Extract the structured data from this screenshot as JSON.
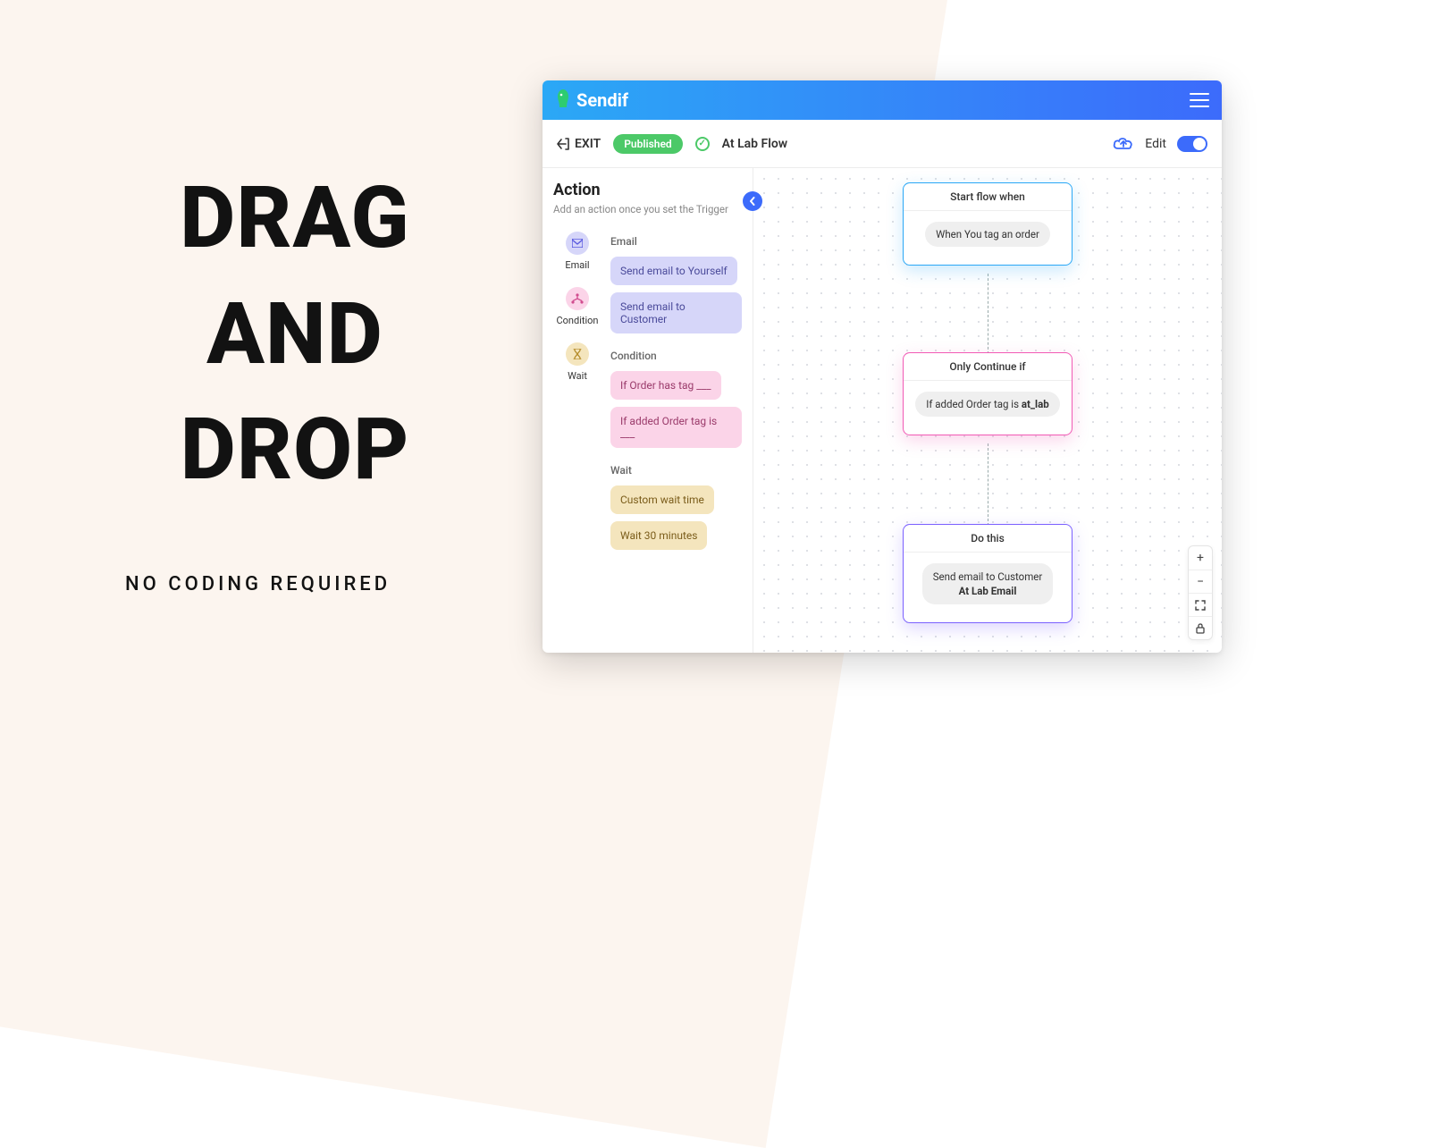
{
  "hero": {
    "line1": "DRAG",
    "line2": "AND",
    "line3": "DROP",
    "subtitle": "NO CODING REQUIRED"
  },
  "app": {
    "brand": "Sendif",
    "toolbar": {
      "exit_label": "EXIT",
      "status_badge": "Published",
      "flow_name": "At Lab Flow",
      "edit_label": "Edit"
    },
    "sidebar": {
      "title": "Action",
      "description": "Add an action once you set the Trigger",
      "tabs": {
        "email": "Email",
        "condition": "Condition",
        "wait": "Wait"
      },
      "groups": {
        "email": {
          "label": "Email",
          "actions": [
            "Send email to Yourself",
            "Send email to Customer"
          ]
        },
        "condition": {
          "label": "Condition",
          "actions": [
            "If Order has tag ___",
            "If added Order tag is ___"
          ]
        },
        "wait": {
          "label": "Wait",
          "actions": [
            "Custom wait time",
            "Wait 30 minutes"
          ]
        }
      }
    },
    "canvas": {
      "trigger": {
        "header": "Start flow when",
        "chip": "When You tag an order"
      },
      "condition": {
        "header": "Only Continue if",
        "chip_prefix": "If added Order tag is ",
        "chip_bold": "at_lab"
      },
      "action": {
        "header": "Do this",
        "chip_line1": "Send email to Customer",
        "chip_line2": "At Lab Email"
      }
    }
  }
}
